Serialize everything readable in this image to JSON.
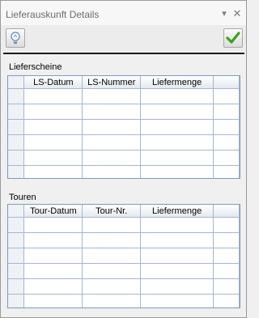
{
  "window": {
    "title": "Lieferauskunft Details",
    "pin_glyph": "▾",
    "close_glyph": "✕"
  },
  "toolbar": {
    "left_icon": "lightbulb-icon",
    "right_icon": "checkmark-icon"
  },
  "lieferscheine": {
    "label": "Lieferscheine",
    "columns": [
      "LS-Datum",
      "LS-Nummer",
      "Liefermenge"
    ],
    "row_count": 8
  },
  "touren": {
    "label": "Touren",
    "columns": [
      "Tour-Datum",
      "Tour-Nr.",
      "Liefermenge"
    ],
    "row_count": 7
  },
  "colors": {
    "grid_border": "#7d9bbd",
    "row_header": "#eef2f7",
    "check_green": "#3fa01f"
  }
}
